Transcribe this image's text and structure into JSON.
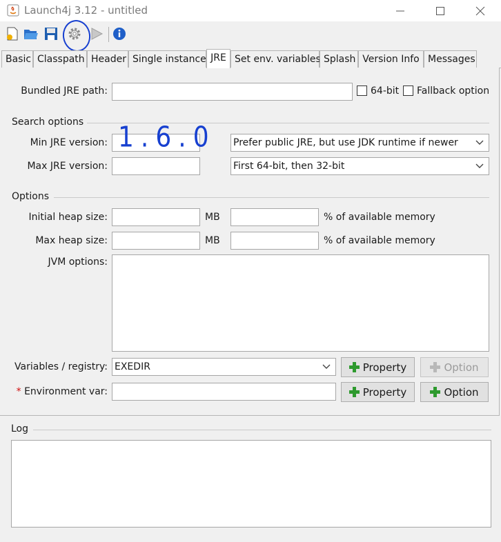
{
  "window": {
    "title": "Launch4j 3.12 - untitled",
    "controls": {
      "minimize": "─",
      "maximize": "☐",
      "close": "✕"
    }
  },
  "toolbar": {
    "buttons": [
      "new-icon",
      "open-icon",
      "save-icon",
      "build-gear-icon",
      "run-triangle-icon",
      "info-icon"
    ],
    "annotation_color": "#1740d0"
  },
  "tabs": [
    {
      "label": "Basic"
    },
    {
      "label": "Classpath"
    },
    {
      "label": "Header"
    },
    {
      "label": "Single instance"
    },
    {
      "label": "JRE",
      "active": true
    },
    {
      "label": "Set env. variables"
    },
    {
      "label": "Splash"
    },
    {
      "label": "Version Info"
    },
    {
      "label": "Messages"
    }
  ],
  "jre": {
    "bundled_path_label": "Bundled JRE path:",
    "bundled_path_value": "",
    "bit64_label": "64-bit",
    "fallback_label": "Fallback option",
    "search_options_title": "Search options",
    "min_version_label": "Min JRE version:",
    "min_version_value": "1.6.0",
    "max_version_label": "Max JRE version:",
    "max_version_value": "",
    "jdk_preference": "Prefer public JRE, but use JDK runtime if newer",
    "runtime_bits": "First 64-bit, then 32-bit"
  },
  "options": {
    "title": "Options",
    "initial_heap_label": "Initial heap size:",
    "max_heap_label": "Max heap size:",
    "mb_unit": "MB",
    "percent_label": "% of available memory",
    "jvm_options_label": "JVM options:",
    "variables_label": "Variables / registry:",
    "variables_value": "EXEDIR",
    "env_required_mark": "*",
    "env_var_label": "Environment var:",
    "property_button": "Property",
    "option_button": "Option"
  },
  "log": {
    "title": "Log"
  },
  "colors": {
    "plus_green": "#2e9a2e",
    "annotation_blue": "#1740d0"
  }
}
